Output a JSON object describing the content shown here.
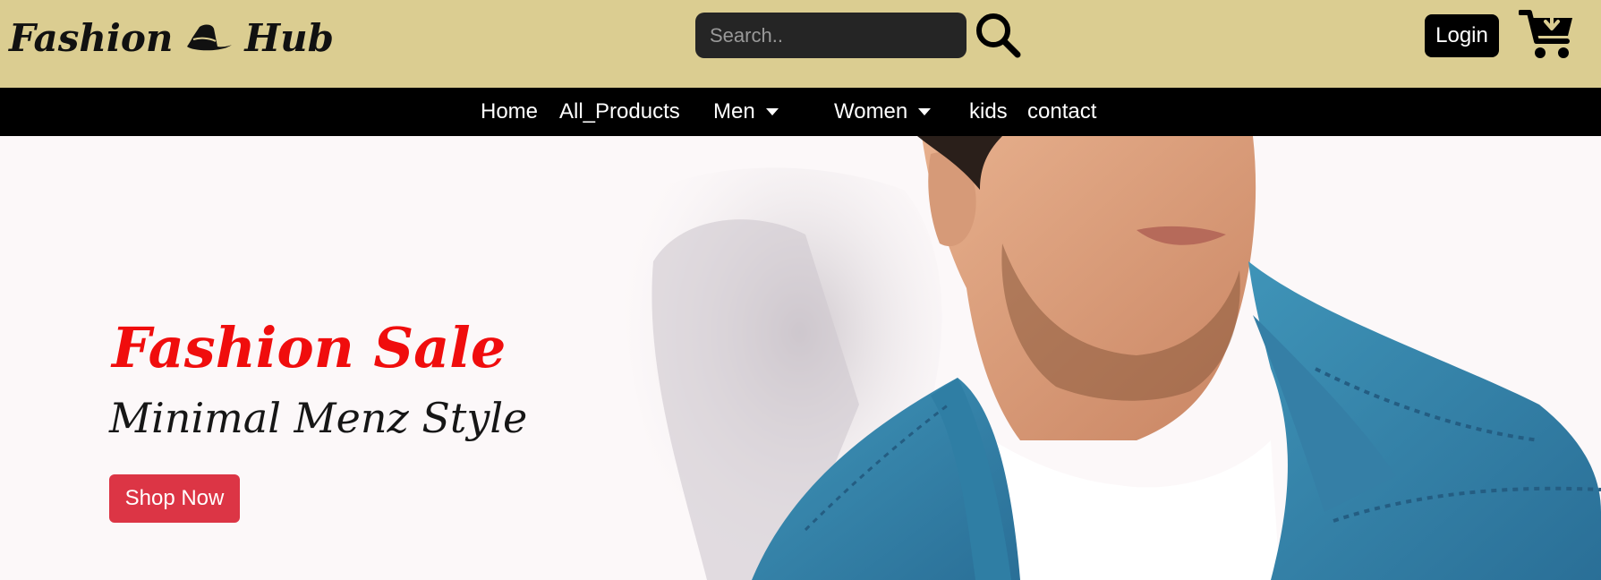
{
  "header": {
    "brand_word1": "Fashion",
    "brand_word2": "Hub",
    "brand_icon": "hat-icon",
    "search": {
      "placeholder": "Search..",
      "icon": "search-icon"
    },
    "login_label": "Login",
    "cart_icon": "cart-icon",
    "background": "#dbcd91"
  },
  "nav": {
    "items": [
      {
        "label": "Home"
      },
      {
        "label": "All_Products"
      },
      {
        "label": "Men",
        "dropdown": true
      },
      {
        "label": "Women",
        "dropdown": true
      },
      {
        "label": "kids"
      },
      {
        "label": "contact"
      }
    ],
    "background": "#000000"
  },
  "hero": {
    "title": "Fashion Sale",
    "subtitle": "Minimal Menz Style",
    "button_label": "Shop Now",
    "title_color": "#f00d0d",
    "button_color": "#dc3545"
  }
}
